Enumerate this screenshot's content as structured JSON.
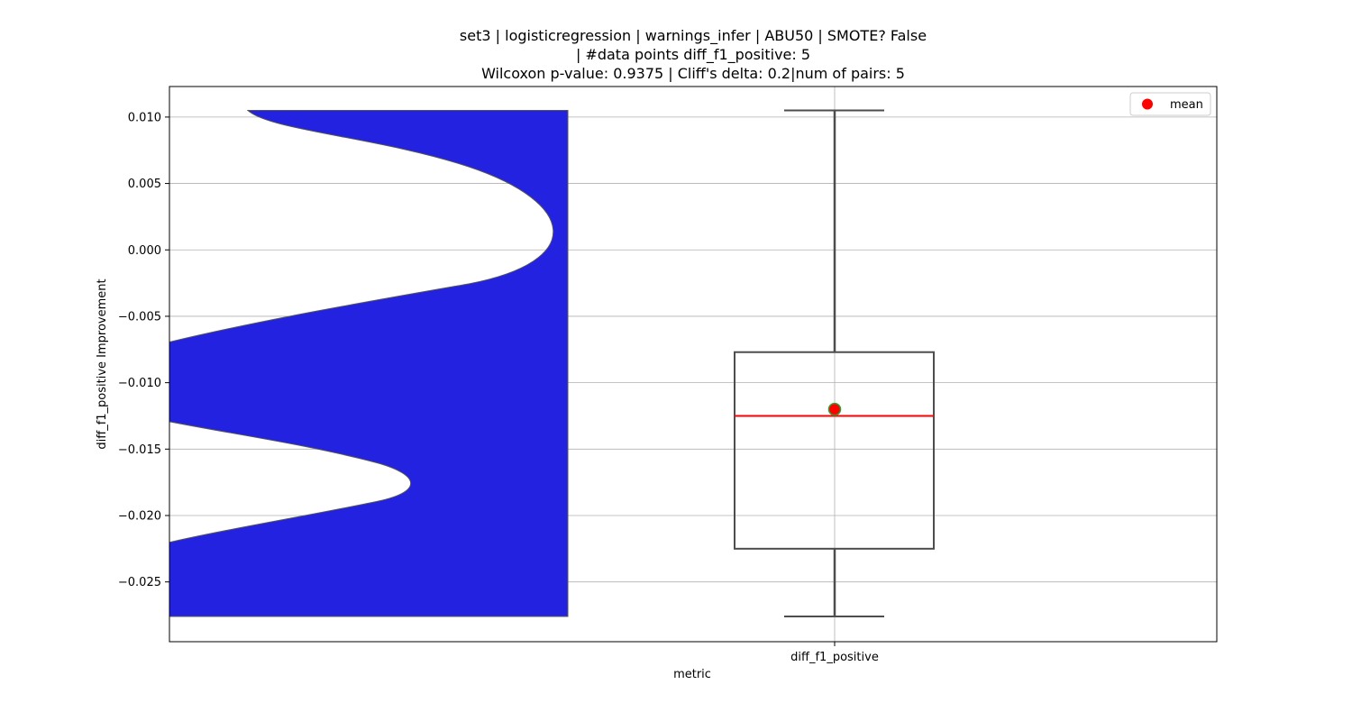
{
  "chart_data": {
    "type": "violin+box",
    "title_lines": [
      "set3 | logisticregression | warnings_infer | ABU50 | SMOTE? False",
      "| #data points diff_f1_positive: 5",
      "Wilcoxon p-value: 0.9375 | Cliff's delta: 0.2|num of pairs: 5"
    ],
    "xlabel": "metric",
    "ylabel": "diff_f1_positive Improvement",
    "categories": [
      "diff_f1_positive"
    ],
    "ylim": [
      -0.0295,
      0.0123
    ],
    "yticks": [
      -0.025,
      -0.02,
      -0.015,
      -0.01,
      -0.005,
      0.0,
      0.005,
      0.01
    ],
    "ytick_labels": [
      "−0.025",
      "−0.020",
      "−0.015",
      "−0.010",
      "−0.005",
      "0.000",
      "0.005",
      "0.010"
    ],
    "grid": true,
    "legend": {
      "position": "top-right",
      "entries": [
        {
          "label": "mean",
          "color": "#ff0000"
        }
      ]
    },
    "violin": {
      "color": "#2222e0",
      "edge_color": "#555555",
      "range": [
        -0.0276,
        0.0105
      ]
    },
    "box": {
      "whisker_low": -0.0276,
      "q1": -0.0225,
      "median": -0.0125,
      "q3": -0.0077,
      "whisker_high": 0.0105,
      "mean": -0.012,
      "median_color": "#ff0000",
      "mean_color": "#ff0000",
      "mean_edge_color": "#2ca02c",
      "box_edge_color": "#4d4d4d"
    }
  }
}
